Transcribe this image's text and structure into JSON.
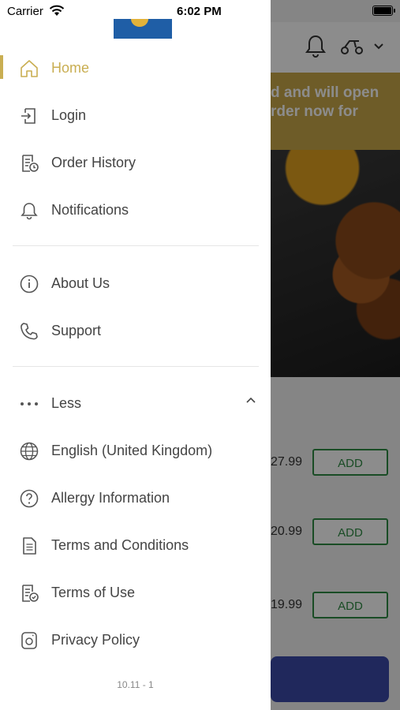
{
  "status_bar": {
    "carrier": "Carrier",
    "time": "6:02 PM"
  },
  "menu": {
    "items": [
      {
        "label": "Home",
        "icon": "home-icon"
      },
      {
        "label": "Login",
        "icon": "login-icon"
      },
      {
        "label": "Order History",
        "icon": "order-history-icon"
      },
      {
        "label": "Notifications",
        "icon": "bell-icon"
      }
    ],
    "info_items": [
      {
        "label": "About Us",
        "icon": "info-icon"
      },
      {
        "label": "Support",
        "icon": "phone-icon"
      }
    ],
    "less_label": "Less",
    "more_items": [
      {
        "label": "English (United Kingdom)",
        "icon": "globe-icon"
      },
      {
        "label": "Allergy Information",
        "icon": "question-icon"
      },
      {
        "label": "Terms and Conditions",
        "icon": "document-icon"
      },
      {
        "label": "Terms of Use",
        "icon": "document-check-icon"
      },
      {
        "label": "Privacy Policy",
        "icon": "privacy-icon"
      }
    ],
    "version": "10.11 - 1"
  },
  "background": {
    "banner_line1": "d and will open",
    "banner_line2": "rder now for",
    "products": [
      {
        "price": "27.99",
        "action": "ADD"
      },
      {
        "price": "20.99",
        "action": "ADD"
      },
      {
        "price": "19.99",
        "action": "ADD"
      }
    ]
  },
  "colors": {
    "accent": "#c9ae52",
    "add_green": "#2f8a44",
    "checkout_blue": "#3b4aa8"
  }
}
